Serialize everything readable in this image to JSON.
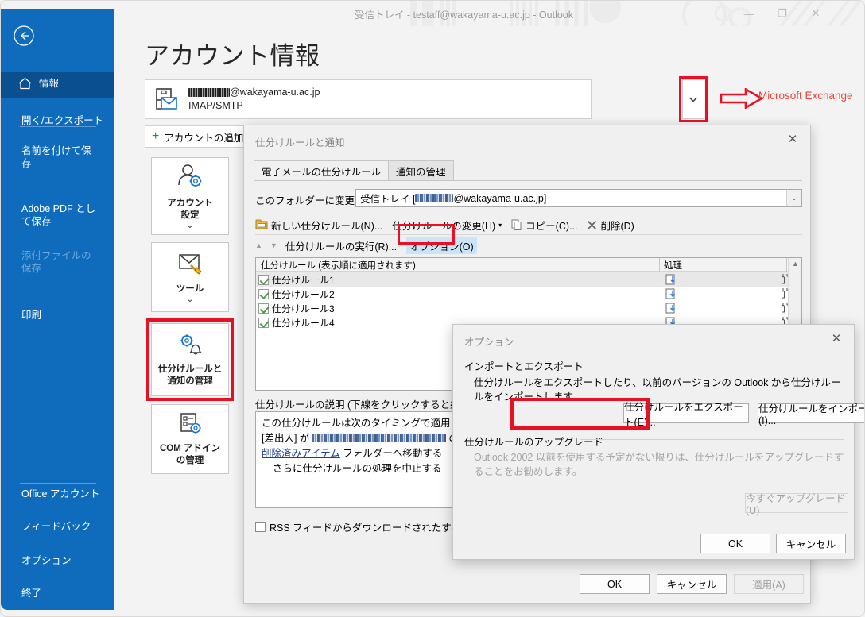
{
  "window": {
    "title": "受信トレイ - testaff@wakayama-u.ac.jp - Outlook",
    "minimize": "—",
    "maximize": "❐",
    "close": "✕"
  },
  "sidebar": {
    "back_icon": "back-arrow-icon",
    "items": [
      {
        "label": "情報",
        "state": "selected",
        "icon": "home-icon"
      },
      {
        "label": "開く/エクスポート",
        "state": "normal"
      },
      {
        "label": "名前を付けて保存",
        "state": "normal"
      },
      {
        "label": "Adobe PDF として保存",
        "state": "normal"
      },
      {
        "label": "添付ファイルの保存",
        "state": "disabled"
      },
      {
        "label": "印刷",
        "state": "normal"
      },
      {
        "label": "Office アカウント",
        "state": "normal"
      },
      {
        "label": "フィードバック",
        "state": "normal"
      },
      {
        "label": "オプション",
        "state": "normal"
      },
      {
        "label": "終了",
        "state": "normal"
      }
    ]
  },
  "backstage": {
    "page_title": "アカウント情報",
    "account": {
      "email_domain": "@wakayama-u.ac.jp",
      "email_redacted": true,
      "type": "IMAP/SMTP",
      "dropdown_icon": "chevron-down-icon"
    },
    "annotation": {
      "text": "Microsoft Exchange",
      "color": "#e8443a",
      "arrow_icon": "right-arrow-annotation-icon"
    },
    "add_account_label": "アカウントの追加",
    "tiles": [
      {
        "label_line1": "アカウント",
        "label_line2": "設定",
        "icon": "account-settings-icon",
        "caret": "⌄"
      },
      {
        "label_line1": "ツール",
        "label_line2": "",
        "icon": "tools-icon",
        "caret": "⌄"
      },
      {
        "label_line1": "仕分けルールと",
        "label_line2": "通知の管理",
        "icon": "rules-alerts-icon",
        "caret": ""
      },
      {
        "label_line1": "COM アドイン",
        "label_line2": "の管理",
        "icon": "com-addins-icon",
        "caret": ""
      }
    ]
  },
  "rules_dialog": {
    "title": "仕分けルールと通知",
    "close_icon": "close-icon",
    "tabs": [
      {
        "label": "電子メールの仕分けルール",
        "active": true
      },
      {
        "label": "通知の管理",
        "active": false
      }
    ],
    "folder_label": "このフォルダーに変更を適用する(F):",
    "folder_value_prefix": "受信トレイ [",
    "folder_value_suffix": "@wakayama-u.ac.jp]",
    "commands_row1": [
      {
        "label": "新しい仕分けルール(N)...",
        "icon": "new-rule-icon"
      },
      {
        "label": "仕分けルールの変更(H)",
        "icon": "change-rule-icon",
        "caret": "▾"
      },
      {
        "label": "コピー(C)...",
        "icon": "copy-icon"
      },
      {
        "label": "削除(D)",
        "icon": "delete-x-icon"
      }
    ],
    "commands_row2": [
      {
        "label": "仕分けルールの実行(R)...",
        "icon": "run-rules-icon"
      },
      {
        "label": "オプション(O)",
        "icon": "options-icon",
        "highlighted": true
      }
    ],
    "move_up_icon": "▲",
    "move_down_icon": "▼",
    "list_headers": [
      "仕分けルール (表示順に適用されます)",
      "処理"
    ],
    "rules": [
      {
        "name": "仕分けルール1",
        "checked": true,
        "selected": true
      },
      {
        "name": "仕分けルール2",
        "checked": true,
        "selected": false
      },
      {
        "name": "仕分けルール3",
        "checked": true,
        "selected": false
      },
      {
        "name": "仕分けルール4",
        "checked": true,
        "selected": false
      }
    ],
    "description_label": "仕分けルールの説明 (下線をクリックすると編集できま",
    "description_lines": {
      "line1": "この仕分けルールは次のタイミングで適用されます: ",
      "line2_prefix": "[差出人] が ",
      "line2_suffix": " の場",
      "line3_link": "削除済みアイテム",
      "line3_rest": " フォルダーへ移動する",
      "line4": "さらに仕分けルールの処理を中止する"
    },
    "rss_checkbox_label": "RSS フィードからダウンロードされたすべてのメッセー",
    "footer_buttons": [
      {
        "label": "OK",
        "disabled": false
      },
      {
        "label": "キャンセル",
        "disabled": false
      },
      {
        "label": "適用(A)",
        "disabled": true
      }
    ]
  },
  "options_dialog": {
    "title": "オプション",
    "close_icon": "close-icon",
    "group1_title": "インポートとエクスポート",
    "group1_text": "仕分けルールをエクスポートしたり、以前のバージョンの Outlook から仕分けルールをインポートします。",
    "export_button": "仕分けルールをエクスポート(E)...",
    "import_button": "仕分けルールをインポート(I)...",
    "group2_title": "仕分けルールのアップグレード",
    "group2_text": "Outlook 2002 以前を使用する予定がない限りは、仕分けルールをアップグレードすることをお勧めします。",
    "upgrade_button": "今すぐアップグレード(U)",
    "ok_button": "OK",
    "cancel_button": "キャンセル"
  },
  "colors": {
    "backstage_blue": "#0f6cbd",
    "backstage_blue_selected": "#0a4f8f",
    "annotation_red": "#e81123",
    "highlight_blue": "#cce4f7"
  }
}
